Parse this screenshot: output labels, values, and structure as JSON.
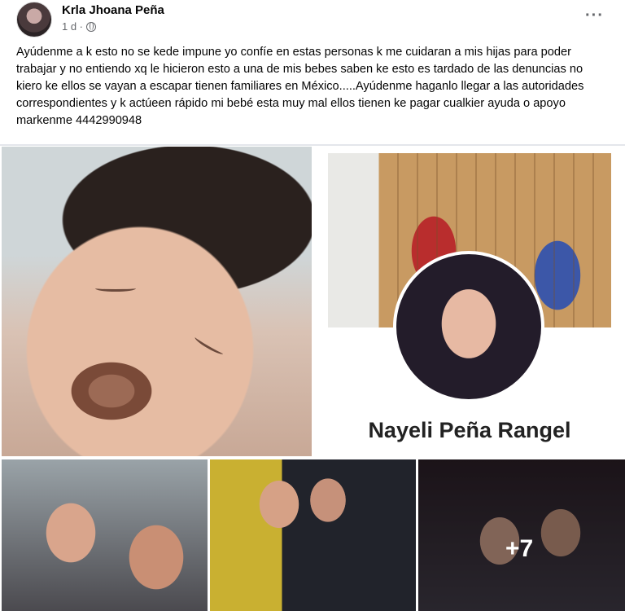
{
  "post": {
    "author": "Krla Jhoana Peña",
    "time": "1 d ·",
    "text": "Ayúdenme a k esto no se kede impune yo confíe en estas personas k me cuidaran a mis hijas para poder trabajar y no entiendo xq le hicieron esto a una de mis bebes saben ke esto es tardado de las denuncias no kiero ke ellos se vayan a escapar tienen familiares en México.....Ayúdenme haganlo llegar a las autoridades correspondientes y k actúeen rápido mi bebé esta muy mal ellos tienen ke pagar cualkier ayuda o apoyo markenme 4442990948",
    "more_icon": "more-options-icon",
    "privacy_icon": "globe-icon"
  },
  "gallery": {
    "profile_card_name": "Nayeli Peña Rangel",
    "more_count": "+7"
  }
}
